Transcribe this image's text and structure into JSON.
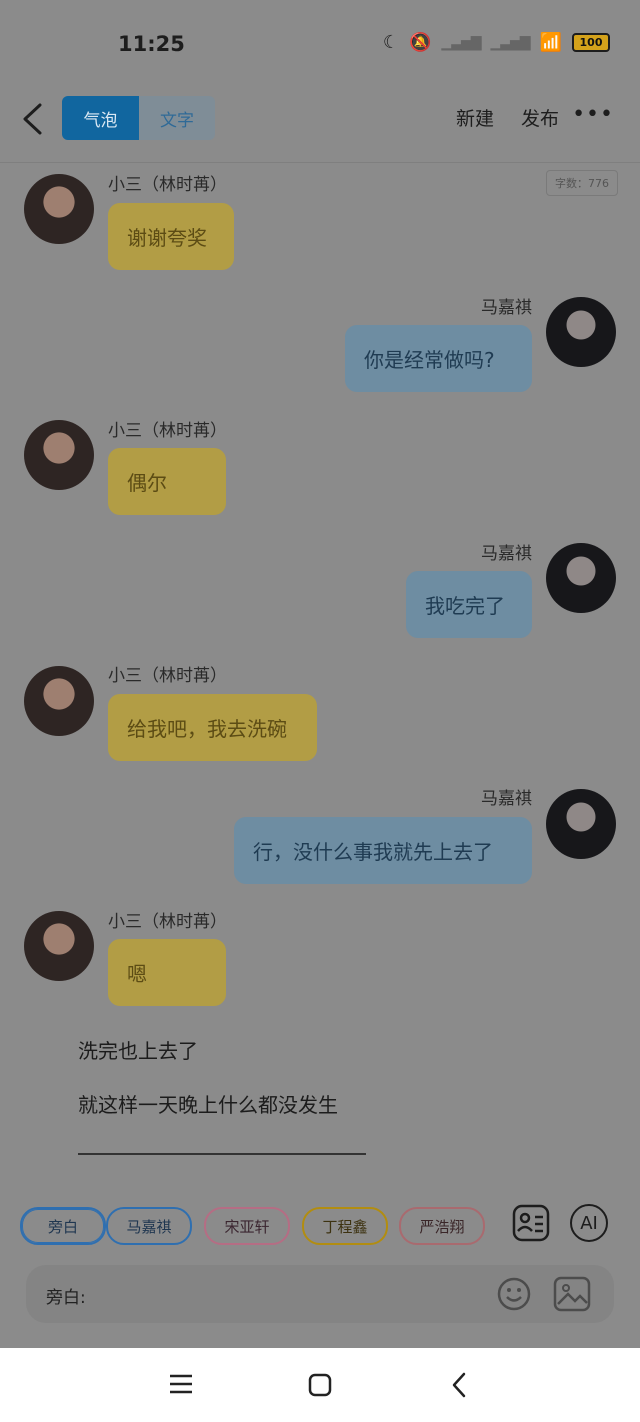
{
  "status": {
    "time": "11:25",
    "battery": "100"
  },
  "appbar": {
    "tabs": [
      "气泡",
      "文字"
    ],
    "actions": [
      "新建",
      "发布"
    ]
  },
  "wordcount": "字数：776",
  "messages": [
    {
      "side": "left",
      "name": "小三（林时苒）",
      "text": "谢谢夸奖"
    },
    {
      "side": "right",
      "name": "马嘉祺",
      "text": "你是经常做吗?"
    },
    {
      "side": "left",
      "name": "小三（林时苒）",
      "text": "偶尔"
    },
    {
      "side": "right",
      "name": "马嘉祺",
      "text": "我吃完了"
    },
    {
      "side": "left",
      "name": "小三（林时苒）",
      "text": "给我吧，我去洗碗"
    },
    {
      "side": "right",
      "name": "马嘉祺",
      "text": "行，没什么事我就先上去了"
    },
    {
      "side": "left",
      "name": "小三（林时苒）",
      "text": "嗯"
    }
  ],
  "narration": [
    "洗完也上去了",
    "就这样一天晚上什么都没发生"
  ],
  "characters": [
    "旁白",
    "马嘉祺",
    "宋亚轩",
    "丁程鑫",
    "严浩翔"
  ],
  "buttons": {
    "ai": "AI"
  },
  "input": {
    "label": "旁白:"
  },
  "colors": {
    "bubble_left": "#b29d45",
    "bubble_right": "#6e8da2",
    "chip_blue": "#2f6fb0",
    "chip_pink": "#b56d84",
    "chip_yellow": "#b28d10",
    "chip_red": "#a96a6f"
  }
}
